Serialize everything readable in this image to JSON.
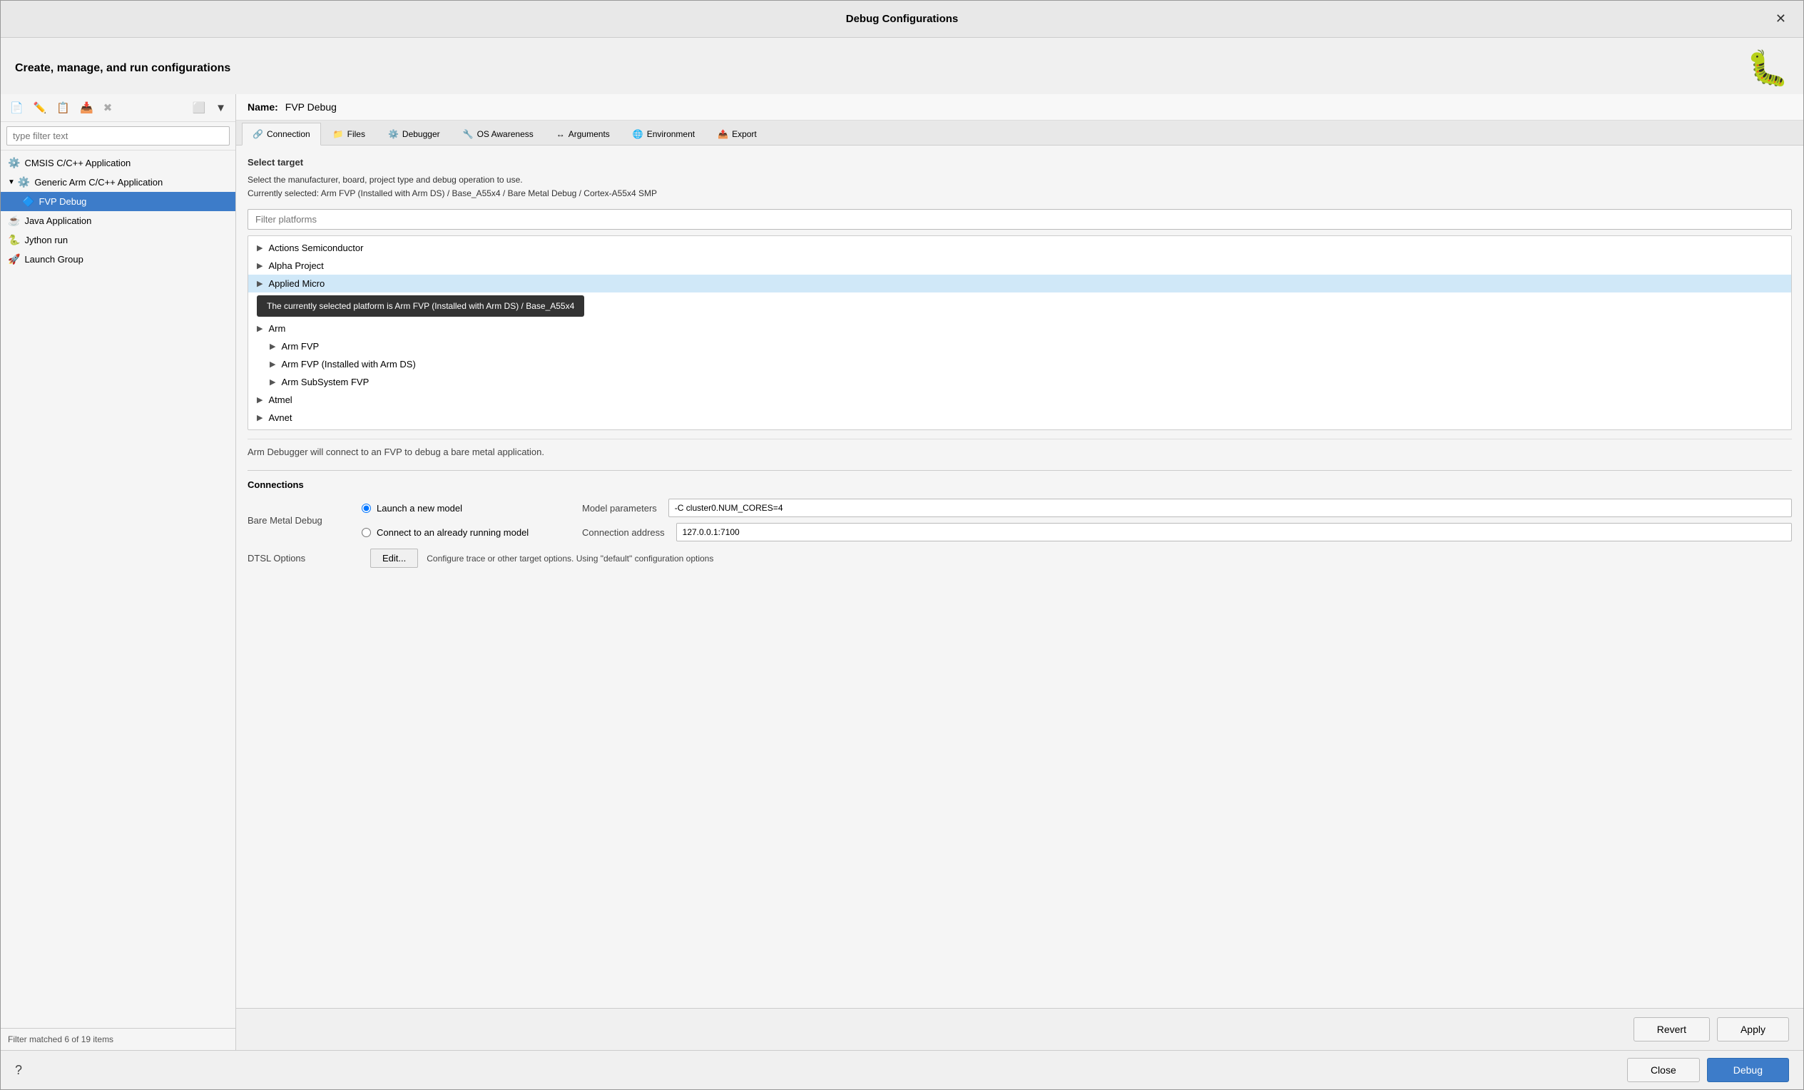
{
  "window": {
    "title": "Debug Configurations",
    "header_text": "Create, manage, and run configurations",
    "bug_icon": "🐛",
    "close_icon": "✕"
  },
  "toolbar": {
    "new_icon": "📄",
    "edit_icon": "✏️",
    "copy_icon": "📋",
    "delete_icon": "✖",
    "filter_icon": "🔽",
    "collapse_icon": "⬜",
    "filter_label": "type filter text"
  },
  "tree": {
    "items": [
      {
        "label": "CMSIS C/C++ Application",
        "icon": "⚙️",
        "level": 0,
        "expandable": false
      },
      {
        "label": "Generic Arm C/C++ Application",
        "icon": "⚙️",
        "level": 0,
        "expandable": true
      },
      {
        "label": "FVP Debug",
        "icon": "🔷",
        "level": 1,
        "selected": true
      },
      {
        "label": "Java Application",
        "icon": "☕",
        "level": 0,
        "expandable": false
      },
      {
        "label": "Jython run",
        "icon": "🐍",
        "level": 0,
        "expandable": false
      },
      {
        "label": "Launch Group",
        "icon": "🚀",
        "level": 0,
        "expandable": false
      }
    ],
    "footer": "Filter matched 6 of 19 items"
  },
  "config": {
    "name_label": "Name:",
    "name_value": "FVP Debug",
    "tabs": [
      {
        "label": "Connection",
        "icon": "🔗",
        "active": true
      },
      {
        "label": "Files",
        "icon": "📁",
        "active": false
      },
      {
        "label": "Debugger",
        "icon": "⚙️",
        "active": false
      },
      {
        "label": "OS Awareness",
        "icon": "🔧",
        "active": false
      },
      {
        "label": "Arguments",
        "icon": "↔",
        "active": false
      },
      {
        "label": "Environment",
        "icon": "🌐",
        "active": false
      },
      {
        "label": "Export",
        "icon": "📤",
        "active": false
      }
    ],
    "select_target": {
      "title": "Select target",
      "description_line1": "Select the manufacturer, board, project type and debug operation to use.",
      "description_line2": "Currently selected: Arm FVP (Installed with Arm DS) / Base_A55x4 / Bare Metal Debug / Cortex-A55x4 SMP",
      "filter_placeholder": "Filter platforms",
      "platforms": [
        {
          "label": "Actions Semiconductor",
          "level": 0
        },
        {
          "label": "Alpha Project",
          "level": 0
        },
        {
          "label": "Applied Micro",
          "level": 0,
          "highlighted": true
        },
        {
          "label": "Arm",
          "level": 0
        },
        {
          "label": "Arm FVP",
          "level": 1
        },
        {
          "label": "Arm FVP (Installed with Arm DS)",
          "level": 1
        },
        {
          "label": "Arm SubSystem FVP",
          "level": 1
        },
        {
          "label": "Atmel",
          "level": 0
        },
        {
          "label": "Avnet",
          "level": 0
        }
      ],
      "tooltip": "The currently selected platform is Arm FVP (Installed with Arm DS) / Base_A55x4"
    },
    "debugger_info": "Arm Debugger will connect to an FVP to debug a bare metal application.",
    "connections": {
      "title": "Connections",
      "bare_metal_label": "Bare Metal Debug",
      "launch_new_label": "Launch a new model",
      "connect_label": "Connect to an already running model",
      "model_params_label": "Model parameters",
      "model_params_value": "-C cluster0.NUM_CORES=4",
      "connection_address_label": "Connection address",
      "connection_address_value": "127.0.0.1:7100",
      "dtsl_options_label": "DTSL Options",
      "edit_btn": "Edit...",
      "dtsl_desc": "Configure  trace or other target options. Using \"default\" configuration options"
    }
  },
  "bottom_bar": {
    "revert_label": "Revert",
    "apply_label": "Apply"
  },
  "window_bottom": {
    "close_label": "Close",
    "debug_label": "Debug",
    "help_icon": "?"
  }
}
